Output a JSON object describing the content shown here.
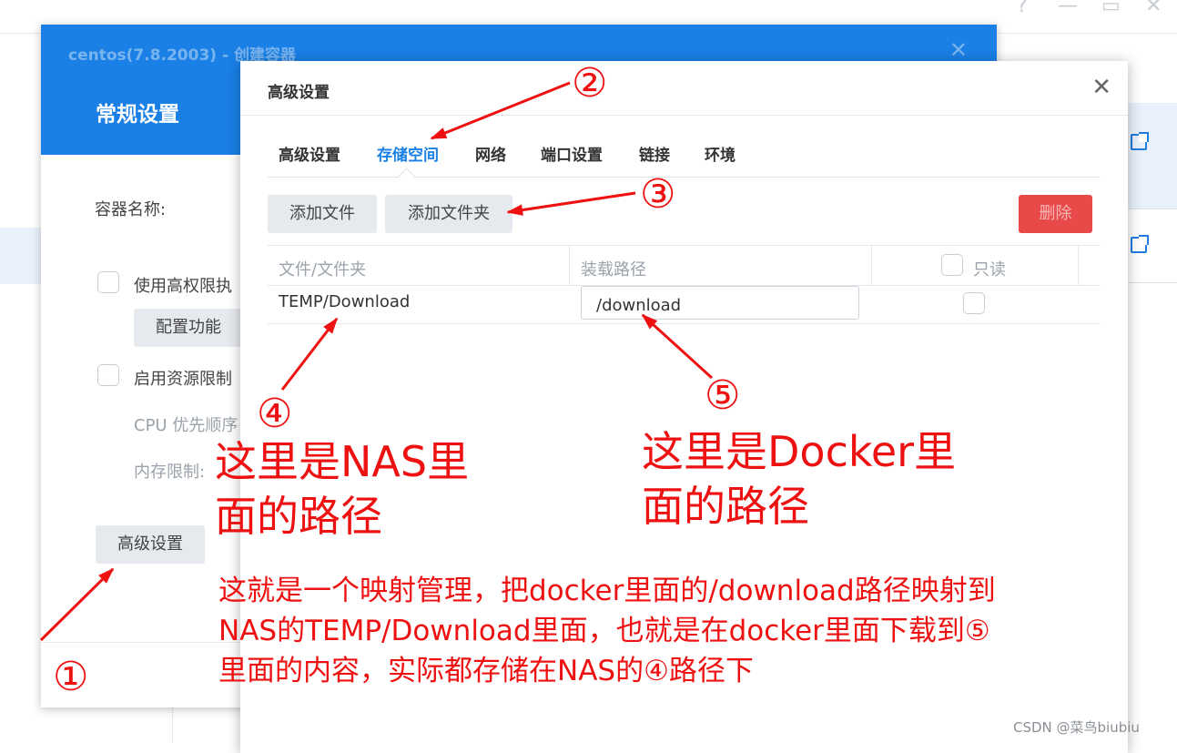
{
  "window_controls": {
    "help": "?",
    "minimize": "—",
    "maximize": "▭",
    "close": "✕"
  },
  "create_dialog": {
    "title": "centos(7.8.2003) - 创建容器",
    "close": "✕",
    "section": "常规设置",
    "container_name_label": "容器名称:",
    "high_priv_label": "使用高权限执",
    "config_button": "配置功能",
    "resource_limit_label": "启用资源限制",
    "cpu_label": "CPU 优先顺序",
    "memory_label": "内存限制:",
    "advanced_button": "高级设置"
  },
  "advanced_dialog": {
    "title": "高级设置",
    "close": "✕",
    "tabs": [
      {
        "label": "高级设置",
        "active": false
      },
      {
        "label": "存储空间",
        "active": true
      },
      {
        "label": "网络",
        "active": false
      },
      {
        "label": "端口设置",
        "active": false
      },
      {
        "label": "链接",
        "active": false
      },
      {
        "label": "环境",
        "active": false
      }
    ],
    "add_file_button": "添加文件",
    "add_folder_button": "添加文件夹",
    "delete_button": "删除",
    "columns": {
      "file": "文件/文件夹",
      "mount": "装载路径",
      "readonly": "只读"
    },
    "rows": [
      {
        "file": "TEMP/Download",
        "mount": "/download",
        "readonly": false
      }
    ]
  },
  "annotations": {
    "c1": "①",
    "c2": "②",
    "c3": "③",
    "c4": "④",
    "c5": "⑤",
    "nas_line1": "这里是NAS里",
    "nas_line2": "面的路径",
    "docker_line1": "这里是Docker里",
    "docker_line2": "面的路径",
    "explain_line1": "这就是一个映射管理，把docker里面的/download路径映射到",
    "explain_line2": "NAS的TEMP/Download里面，也就是在docker里面下载到⑤",
    "explain_line3": "里面的内容，实际都存储在NAS的④路径下"
  },
  "watermark": "CSDN @菜鸟biubiu",
  "colors": {
    "accent": "#1a80e6",
    "danger": "#e84a4a",
    "annotation": "#ee1111"
  }
}
